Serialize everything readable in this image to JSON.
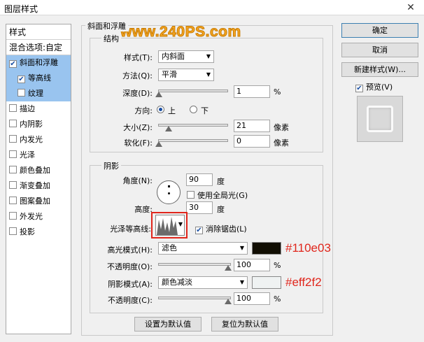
{
  "window": {
    "title": "图层样式",
    "close_glyph": "✕"
  },
  "watermark": "www.240PS.com",
  "style_list": {
    "header": "样式",
    "blend_options": "混合选项:自定",
    "items": [
      {
        "label": "斜面和浮雕",
        "checked": true
      },
      {
        "label": "等高线",
        "checked": true
      },
      {
        "label": "纹理",
        "checked": false
      },
      {
        "label": "描边",
        "checked": false
      },
      {
        "label": "内阴影",
        "checked": false
      },
      {
        "label": "内发光",
        "checked": false
      },
      {
        "label": "光泽",
        "checked": false
      },
      {
        "label": "颜色叠加",
        "checked": false
      },
      {
        "label": "渐变叠加",
        "checked": false
      },
      {
        "label": "图案叠加",
        "checked": false
      },
      {
        "label": "外发光",
        "checked": false
      },
      {
        "label": "投影",
        "checked": false
      }
    ]
  },
  "bevel": {
    "legend": "斜面和浮雕",
    "structure_legend": "结构",
    "style_label": "样式(T):",
    "style_value": "内斜面",
    "technique_label": "方法(Q):",
    "technique_value": "平滑",
    "depth_label": "深度(D):",
    "depth_value": "1",
    "depth_unit": "%",
    "direction_label": "方向:",
    "dir_up": "上",
    "dir_down": "下",
    "size_label": "大小(Z):",
    "size_value": "21",
    "size_unit": "像素",
    "soften_label": "软化(F):",
    "soften_value": "0",
    "soften_unit": "像素"
  },
  "shading": {
    "legend": "阴影",
    "angle_label": "角度(N):",
    "angle_value": "90",
    "angle_unit": "度",
    "global_light_label": "使用全局光(G)",
    "altitude_label": "高度:",
    "altitude_value": "30",
    "altitude_unit": "度",
    "gloss_label": "光泽等高线:",
    "anti_alias_label": "消除锯齿(L)",
    "highlight_label": "高光模式(H):",
    "highlight_mode": "滤色",
    "highlight_color": "#110e03",
    "opacity1_label": "不透明度(O):",
    "opacity1_value": "100",
    "opacity1_unit": "%",
    "shadow_label": "阴影模式(A):",
    "shadow_mode": "颜色减淡",
    "shadow_color": "#eff2f2",
    "opacity2_label": "不透明度(C):",
    "opacity2_value": "100",
    "opacity2_unit": "%"
  },
  "annotations": {
    "highlight_hex": "#110e03",
    "shadow_hex": "#eff2f2"
  },
  "footer": {
    "make_default": "设置为默认值",
    "reset_default": "复位为默认值"
  },
  "right_panel": {
    "ok": "确定",
    "cancel": "取消",
    "new_style": "新建样式(W)...",
    "preview": "预览(V)"
  },
  "colors": {
    "selection": "#99c4ef",
    "annotation": "#e0261c",
    "watermark": "#f5a623"
  }
}
